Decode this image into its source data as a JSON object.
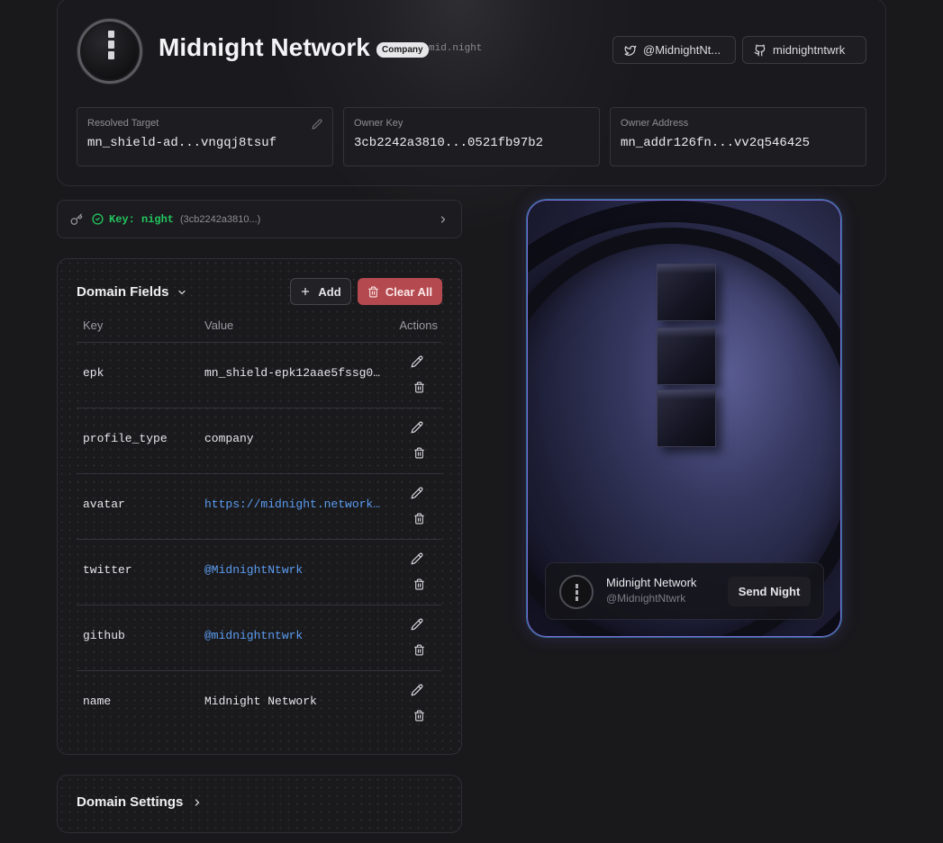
{
  "profile": {
    "name": "Midnight Network",
    "badge": "Company",
    "domain": "mid.night"
  },
  "socials": {
    "twitter_label": "@MidnightNt...",
    "github_label": "midnightntwrk"
  },
  "info": {
    "resolved_target_label": "Resolved Target",
    "resolved_target_value": "mn_shield-ad...vngqj8tsuf",
    "owner_key_label": "Owner Key",
    "owner_key_value": "3cb2242a3810...0521fb97b2",
    "owner_address_label": "Owner Address",
    "owner_address_value": "mn_addr126fn...vv2q546425"
  },
  "key_bar": {
    "label": "Key: night",
    "sub": "(3cb2242a3810...)"
  },
  "domain_fields": {
    "title": "Domain Fields",
    "add_label": "Add",
    "clear_label": "Clear All",
    "columns": [
      "Key",
      "Value",
      "Actions"
    ],
    "rows": [
      {
        "key": "epk",
        "value": "mn_shield-epk12aae5fssg0u..."
      },
      {
        "key": "profile_type",
        "value": "company"
      },
      {
        "key": "avatar",
        "value": "https://midnight.network/..."
      },
      {
        "key": "twitter",
        "value": "@MidnightNtwrk"
      },
      {
        "key": "github",
        "value": "@midnightntwrk"
      },
      {
        "key": "name",
        "value": "Midnight Network"
      }
    ]
  },
  "domain_settings": {
    "title": "Domain Settings"
  },
  "preview": {
    "name": "Midnight Network",
    "handle": "@MidnightNtwrk",
    "send_label": "Send Night"
  },
  "colors": {
    "background": "#19191c",
    "accent_green": "#22c55e",
    "link_blue": "#5b9cf0",
    "danger": "#b44a4f",
    "preview_border": "#7b6ad6"
  }
}
